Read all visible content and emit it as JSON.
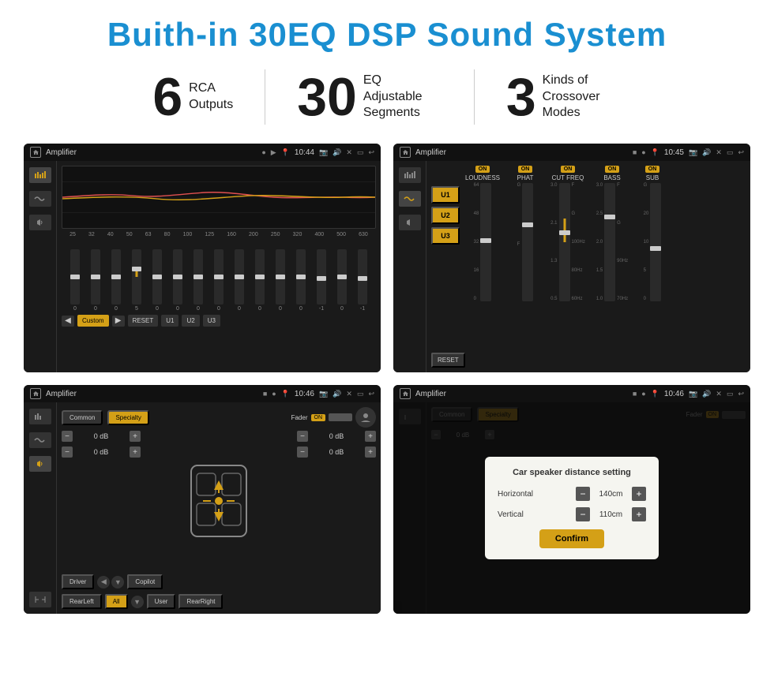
{
  "header": {
    "title": "Buith-in 30EQ DSP Sound System"
  },
  "stats": [
    {
      "number": "6",
      "label": "RCA\nOutputs"
    },
    {
      "number": "30",
      "label": "EQ Adjustable\nSegments"
    },
    {
      "number": "3",
      "label": "Kinds of\nCrossover Modes"
    }
  ],
  "screens": {
    "eq": {
      "topbar_title": "Amplifier",
      "time": "10:44",
      "freqs": [
        "25",
        "32",
        "40",
        "50",
        "63",
        "80",
        "100",
        "125",
        "160",
        "200",
        "250",
        "320",
        "400",
        "500",
        "630"
      ],
      "values": [
        "0",
        "0",
        "0",
        "5",
        "0",
        "0",
        "0",
        "0",
        "0",
        "0",
        "0",
        "0",
        "-1",
        "0",
        "-1"
      ],
      "buttons": [
        "Custom",
        "RESET",
        "U1",
        "U2",
        "U3"
      ]
    },
    "crossover": {
      "topbar_title": "Amplifier",
      "time": "10:45",
      "presets": [
        "U1",
        "U2",
        "U3"
      ],
      "channels": [
        "LOUDNESS",
        "PHAT",
        "CUT FREQ",
        "BASS",
        "SUB"
      ],
      "reset_label": "RESET"
    },
    "speaker": {
      "topbar_title": "Amplifier",
      "time": "10:46",
      "tabs": [
        "Common",
        "Specialty"
      ],
      "fader_label": "Fader",
      "fader_on": "ON",
      "db_values": [
        "0 dB",
        "0 dB",
        "0 dB",
        "0 dB"
      ],
      "locations": [
        "Driver",
        "RearLeft",
        "All",
        "User",
        "RearRight",
        "Copilot"
      ]
    },
    "dialog": {
      "topbar_title": "Amplifier",
      "time": "10:46",
      "title": "Car speaker distance setting",
      "horizontal_label": "Horizontal",
      "horizontal_value": "140cm",
      "vertical_label": "Vertical",
      "vertical_value": "110cm",
      "confirm_label": "Confirm"
    }
  }
}
